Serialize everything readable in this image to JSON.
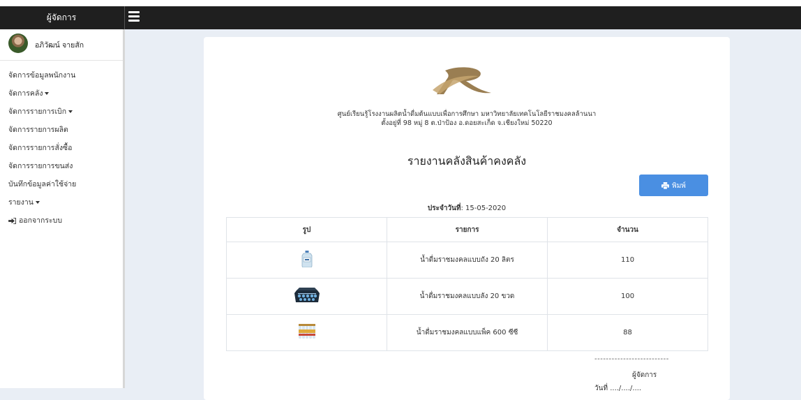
{
  "header": {
    "brand": "ผู้จัดการ"
  },
  "user": {
    "name": "อภิวัฒน์ จายสัก"
  },
  "sidebar": {
    "items": [
      {
        "label": "จัดการข้อมูลพนักงาน"
      },
      {
        "label": "จัดการคลัง"
      },
      {
        "label": "จัดการรายการเบิก"
      },
      {
        "label": "จัดการรายการผลิต"
      },
      {
        "label": "จัดการรายการสั่งซื้อ"
      },
      {
        "label": "จัดการรายการขนส่ง"
      },
      {
        "label": "บันทึกข้อมูลค่าใช้จ่าย"
      },
      {
        "label": "รายงาน"
      },
      {
        "label": "ออกจากระบบ"
      }
    ]
  },
  "report": {
    "org_line1": "ศูนย์เรียนรู้โรงงานผลิตน้ำดื่มต้นแบบเพื่อการศึกษา มหาวิทยาลัยเทคโนโลยีราชมงคลล้านนา",
    "org_line2": "ตั้งอยู่ที่ 98 หมู่ 8 ต.ป่าป้อง อ.ดอยสะเก็ด จ.เชียงใหม่ 50220",
    "title": "รายงานคลังสินค้าคงคลัง",
    "print_label": "พิมพ์",
    "date_label": "ประจำวันที่",
    "date_value": ": 15-05-2020",
    "columns": [
      "รูป",
      "รายการ",
      "จำนวน"
    ],
    "rows": [
      {
        "image": "water-tank-image",
        "name": "น้ำดื่มราชมงคลแบบถัง 20 ลิตร",
        "qty": "110"
      },
      {
        "image": "water-crate-image",
        "name": "น้ำดื่มราชมงคลแบบลัง 20 ขวด",
        "qty": "100"
      },
      {
        "image": "water-pack-image",
        "name": "น้ำดื่มราชมงคลแบบแพ็ค 600 ซีซี",
        "qty": "88"
      }
    ],
    "signature_line": "--------------------------",
    "signature_role": "ผู้จัดการ",
    "signature_date": "วันที่ ..../..../...."
  },
  "colors": {
    "topbar": "#1f1f1f",
    "print_button": "#4a8fe2",
    "background": "#e9eef5"
  }
}
